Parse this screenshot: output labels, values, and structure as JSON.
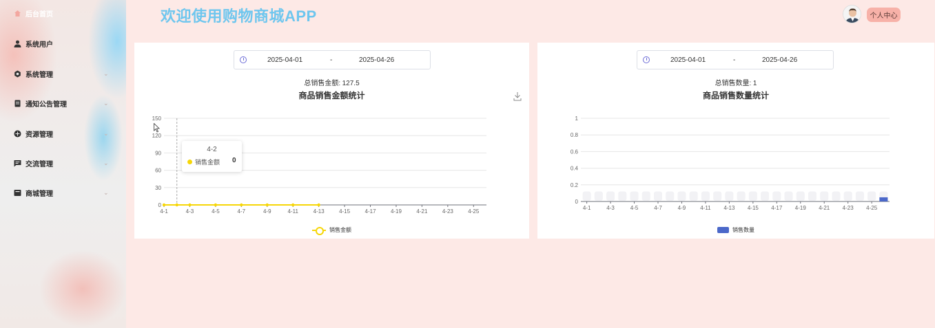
{
  "app": {
    "title": "欢迎使用购物商城APP",
    "profile_label": "个人中心"
  },
  "sidebar": {
    "items": [
      {
        "label": "后台首页",
        "icon": "home-icon"
      },
      {
        "label": "系统用户",
        "icon": "user-icon"
      },
      {
        "label": "系统管理",
        "icon": "gear-icon"
      },
      {
        "label": "通知公告管理",
        "icon": "notice-icon"
      },
      {
        "label": "资源管理",
        "icon": "resource-icon"
      },
      {
        "label": "交流管理",
        "icon": "chat-icon"
      },
      {
        "label": "商城管理",
        "icon": "shop-icon"
      }
    ]
  },
  "left_panel": {
    "date_start": "2025-04-01",
    "date_sep": "-",
    "date_end": "2025-04-26",
    "total_label": "总销售金额:",
    "total_value": "127.5",
    "title": "商品销售金额统计",
    "tooltip": {
      "category": "4-2",
      "series": "销售金额",
      "value": "0"
    },
    "legend": "销售金额"
  },
  "right_panel": {
    "date_start": "2025-04-01",
    "date_sep": "-",
    "date_end": "2025-04-26",
    "total_label": "总销售数量:",
    "total_value": "1",
    "title": "商品销售数量统计",
    "legend": "销售数量"
  },
  "chart_data": [
    {
      "type": "line",
      "title": "商品销售金额统计",
      "categories": [
        "4-1",
        "4-2",
        "4-3",
        "4-4",
        "4-5",
        "4-6",
        "4-7",
        "4-8",
        "4-9",
        "4-10",
        "4-11",
        "4-12",
        "4-13",
        "4-14",
        "4-15",
        "4-16",
        "4-17",
        "4-18",
        "4-19",
        "4-20",
        "4-21",
        "4-22",
        "4-23",
        "4-24",
        "4-25",
        "4-26"
      ],
      "tick_labels": [
        "4-1",
        "4-3",
        "4-5",
        "4-7",
        "4-9",
        "4-11",
        "4-13",
        "4-15",
        "4-17",
        "4-19",
        "4-21",
        "4-23",
        "4-25"
      ],
      "series": [
        {
          "name": "销售金额",
          "values": [
            0,
            0,
            0,
            0,
            0,
            0,
            0,
            0,
            0,
            0,
            0,
            0,
            0
          ]
        }
      ],
      "yticks": [
        0,
        30,
        60,
        90,
        120,
        150
      ],
      "ylim": [
        0,
        150
      ],
      "color": "#f6d607",
      "grid": true,
      "legend": "bottom-center"
    },
    {
      "type": "bar",
      "title": "商品销售数量统计",
      "categories": [
        "4-1",
        "4-2",
        "4-3",
        "4-4",
        "4-5",
        "4-6",
        "4-7",
        "4-8",
        "4-9",
        "4-10",
        "4-11",
        "4-12",
        "4-13",
        "4-14",
        "4-15",
        "4-16",
        "4-17",
        "4-18",
        "4-19",
        "4-20",
        "4-21",
        "4-22",
        "4-23",
        "4-24",
        "4-25",
        "4-26"
      ],
      "tick_labels": [
        "4-1",
        "4-3",
        "4-5",
        "4-7",
        "4-9",
        "4-11",
        "4-13",
        "4-15",
        "4-17",
        "4-19",
        "4-21",
        "4-23",
        "4-25"
      ],
      "series": [
        {
          "name": "销售数量",
          "values": [
            0,
            0,
            0,
            0,
            0,
            0,
            0,
            0,
            0,
            0,
            0,
            0,
            0,
            0,
            0,
            0,
            0,
            0,
            0,
            0,
            0,
            0,
            0,
            0,
            0,
            0.05
          ]
        }
      ],
      "yticks": [
        "0",
        "0.2",
        "0.4",
        "0.6",
        "0.8",
        "1"
      ],
      "ylim": [
        0,
        1
      ],
      "color": "#4b68c9",
      "grid": true,
      "legend": "bottom-center"
    }
  ]
}
